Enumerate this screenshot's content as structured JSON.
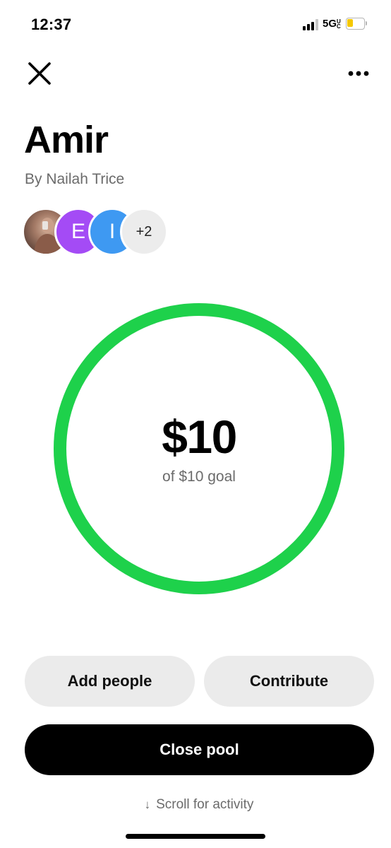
{
  "status_bar": {
    "time": "12:37",
    "network": "5G",
    "network_badge": "UC",
    "signal_icon": "signal-bars-icon",
    "battery_icon": "battery-icon",
    "battery_level": 0.4,
    "battery_color": "#f5c800"
  },
  "nav": {
    "close_icon": "close-icon",
    "more_icon": "more-options-icon"
  },
  "pool": {
    "title": "Amir",
    "owner": "By Nailah Trice",
    "participants": [
      {
        "type": "photo",
        "initial": ""
      },
      {
        "type": "letter",
        "initial": "E",
        "color": "#a44bf5"
      },
      {
        "type": "letter",
        "initial": "I",
        "color": "#3e99f2"
      }
    ],
    "more_count": "+2",
    "amount": "$10",
    "goal_text": "of $10 goal",
    "progress": 1.0,
    "ring_color": "#1ed14b"
  },
  "actions": {
    "add_people": "Add people",
    "contribute": "Contribute",
    "close_pool": "Close pool",
    "scroll_hint": "Scroll for activity",
    "scroll_icon": "arrow-down-icon"
  }
}
